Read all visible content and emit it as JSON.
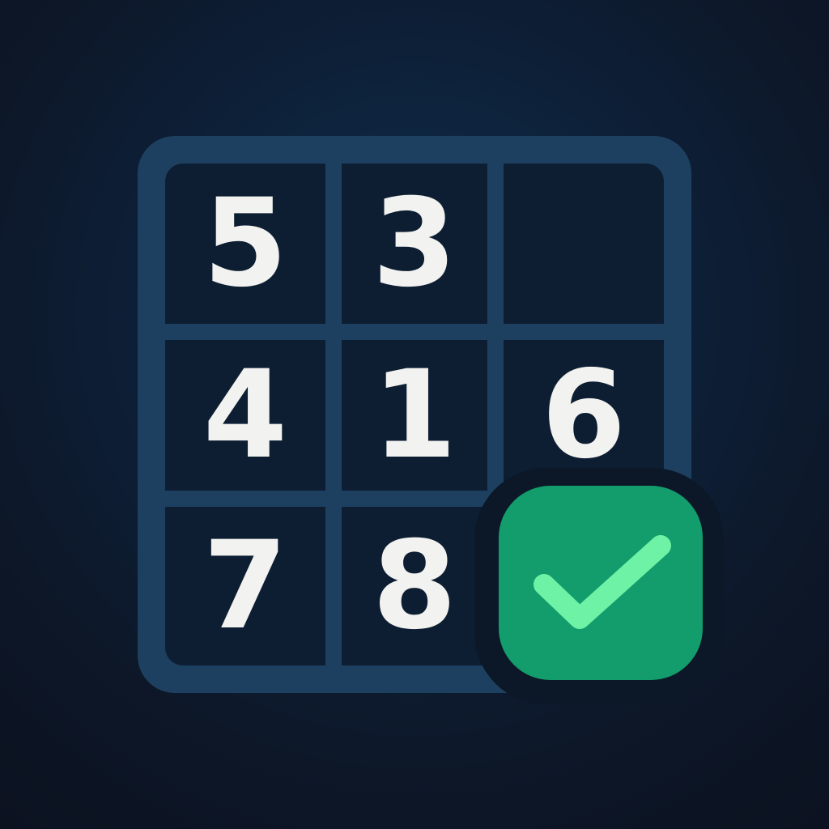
{
  "puzzle": {
    "cells": [
      "5",
      "3",
      "",
      "4",
      "1",
      "6",
      "7",
      "8",
      ""
    ]
  },
  "badge": {
    "icon": "checkmark-icon",
    "color": "#139c6c",
    "check_color": "#6ef2a6"
  },
  "colors": {
    "background": "#0d1728",
    "grid_frame": "#1e4060",
    "cell": "#0d1e32",
    "digit": "#f2f2f0"
  }
}
